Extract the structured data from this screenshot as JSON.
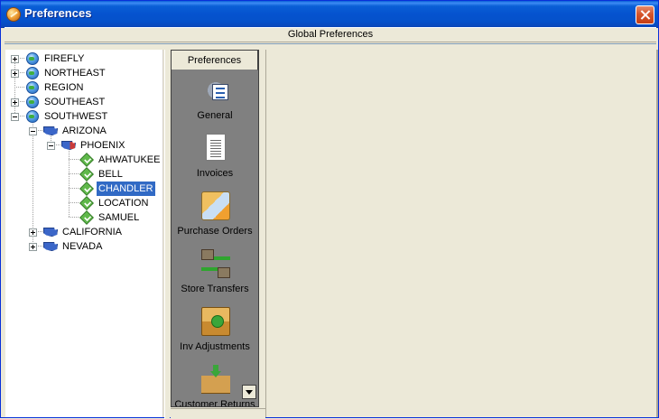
{
  "window": {
    "title": "Preferences"
  },
  "header": {
    "title": "Global Preferences"
  },
  "tree": {
    "nodes": [
      {
        "label": "FIREFLY",
        "icon": "globe-icon",
        "expander": "plus"
      },
      {
        "label": "NORTHEAST",
        "icon": "globe-icon",
        "expander": "plus"
      },
      {
        "label": "REGION",
        "icon": "globe-icon",
        "expander": "none"
      },
      {
        "label": "SOUTHEAST",
        "icon": "globe-icon",
        "expander": "plus"
      },
      {
        "label": "SOUTHWEST",
        "icon": "globe-icon",
        "expander": "minus"
      },
      {
        "label": "ARIZONA",
        "icon": "state-map-icon",
        "expander": "minus"
      },
      {
        "label": "PHOENIX",
        "icon": "city-map-icon",
        "expander": "minus"
      },
      {
        "label": "AHWATUKEE",
        "icon": "store-icon",
        "expander": "none"
      },
      {
        "label": "BELL",
        "icon": "store-icon",
        "expander": "none"
      },
      {
        "label": "CHANDLER",
        "icon": "store-icon",
        "expander": "none",
        "selected": true
      },
      {
        "label": "LOCATION",
        "icon": "store-icon",
        "expander": "none"
      },
      {
        "label": "SAMUEL",
        "icon": "store-icon",
        "expander": "none"
      },
      {
        "label": "CALIFORNIA",
        "icon": "state-map-icon",
        "expander": "plus"
      },
      {
        "label": "NEVADA",
        "icon": "state-map-icon",
        "expander": "plus"
      }
    ]
  },
  "nav": {
    "header": "Preferences",
    "items": [
      {
        "label": "General",
        "icon": "settings-gear-icon"
      },
      {
        "label": "Invoices",
        "icon": "document-icon"
      },
      {
        "label": "Purchase Orders",
        "icon": "purchase-order-icon"
      },
      {
        "label": "Store Transfers",
        "icon": "store-transfer-icon"
      },
      {
        "label": "Inv Adjustments",
        "icon": "inventory-box-icon"
      },
      {
        "label": "Customer Returns",
        "icon": "customer-return-icon"
      }
    ]
  }
}
